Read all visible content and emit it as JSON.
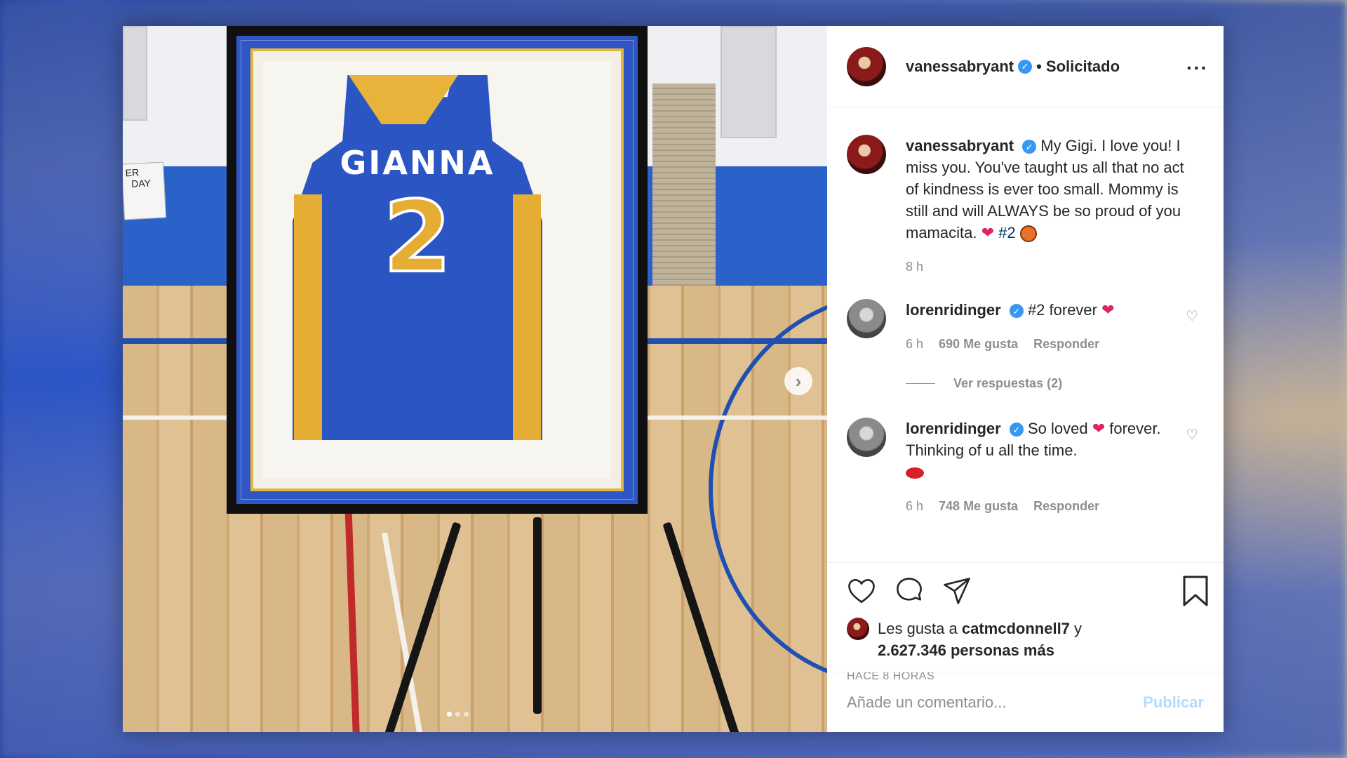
{
  "header": {
    "username": "vanessabryant",
    "follow_status": "• Solicitado",
    "more": "···"
  },
  "photo": {
    "jersey_name": "GIANNA",
    "jersey_number": "2",
    "banner_text": "ER\nDAY",
    "carousel_index": 1,
    "carousel_total": 3
  },
  "caption": {
    "username": "vanessabryant",
    "text": "My Gigi. I love you! I miss you. You've taught us all that no act of kindness is ever too small. Mommy is still and will ALWAYS be so proud of you mamacita.",
    "hashtag": "#2",
    "time": "8 h"
  },
  "comments": [
    {
      "username": "lorenridinger",
      "text": "#2 forever",
      "time": "6 h",
      "likes": "690 Me gusta",
      "reply": "Responder",
      "view_replies": "Ver respuestas (2)"
    },
    {
      "username": "lorenridinger",
      "text": "So loved",
      "text2": "forever. Thinking of u all the time.",
      "time": "6 h",
      "likes": "748 Me gusta",
      "reply": "Responder"
    }
  ],
  "likes": {
    "prefix": "Les gusta a",
    "user": "catmcdonnell7",
    "suffix": "y",
    "count": "2.627.346 personas más"
  },
  "timestamp": "HACE 8 HORAS",
  "comment_box": {
    "placeholder": "Añade un comentario...",
    "publish": "Publicar"
  },
  "colors": {
    "verified": "#3897f0",
    "publish_disabled": "#b3dbff",
    "heart": "#e0245e"
  }
}
